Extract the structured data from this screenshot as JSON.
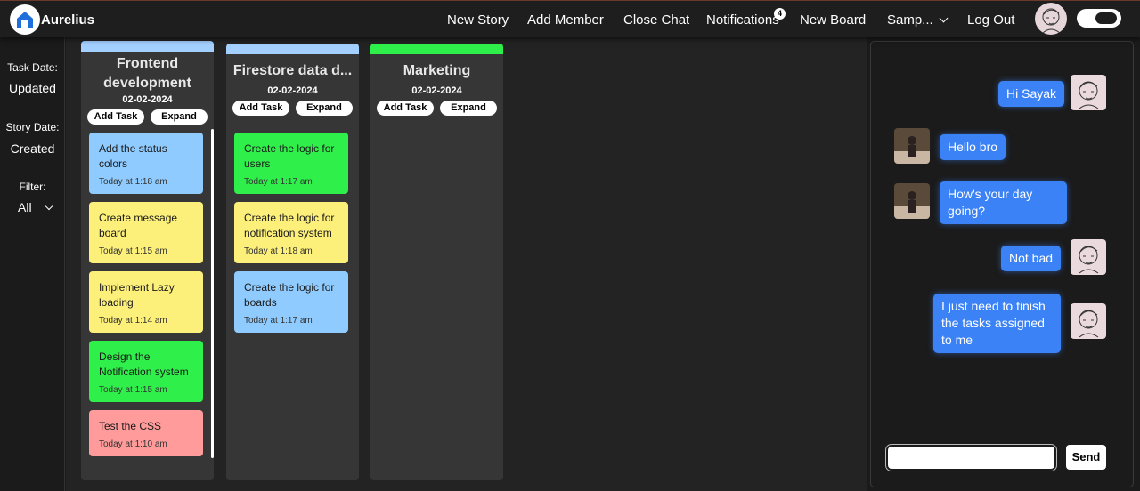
{
  "header": {
    "brand": "Aurelius",
    "nav": [
      {
        "label": "New Story"
      },
      {
        "label": "Add Member"
      },
      {
        "label": "Close Chat"
      },
      {
        "label": "Notifications"
      },
      {
        "label": "New Board"
      },
      {
        "label": "Samp..."
      },
      {
        "label": "Log Out"
      }
    ],
    "notification_count": "4"
  },
  "sidebar": {
    "task_date_label": "Task Date:",
    "task_date_value": "Updated",
    "story_date_label": "Story Date:",
    "story_date_value": "Created",
    "filter_label": "Filter:",
    "filter_value": "All"
  },
  "columns": [
    {
      "title": "Frontend development",
      "date": "02-02-2024",
      "bar_color": "#a3d0ff",
      "add_label": "Add Task",
      "expand_label": "Expand",
      "cards": [
        {
          "title": "Add the status colors",
          "time": "Today at 1:18 am",
          "color": "#8fcbff"
        },
        {
          "title": "Create message board",
          "time": "Today at 1:15 am",
          "color": "#fdf07a"
        },
        {
          "title": "Implement Lazy loading",
          "time": "Today at 1:14 am",
          "color": "#fdf07a"
        },
        {
          "title": "Design the Notification system",
          "time": "Today at 1:15 am",
          "color": "#2ff04a"
        },
        {
          "title": "Test the CSS",
          "time": "Today at 1:10 am",
          "color": "#ff9b9b"
        }
      ]
    },
    {
      "title": "Firestore data d...",
      "date": "02-02-2024",
      "bar_color": "#a3d0ff",
      "add_label": "Add Task",
      "expand_label": "Expand",
      "cards": [
        {
          "title": "Create the logic for users",
          "time": "Today at 1:17 am",
          "color": "#2ff04a"
        },
        {
          "title": "Create the logic for notification system",
          "time": "Today at 1:18 am",
          "color": "#fdf07a"
        },
        {
          "title": "Create the logic for boards",
          "time": "Today at 1:17 am",
          "color": "#8fcbff"
        }
      ]
    },
    {
      "title": "Marketing",
      "date": "02-02-2024",
      "bar_color": "#2ff04a",
      "add_label": "Add Task",
      "expand_label": "Expand",
      "cards": []
    }
  ],
  "chat": {
    "messages": [
      {
        "text": "Hi Sayak",
        "from": "me"
      },
      {
        "text": "Hello bro",
        "from": "other"
      },
      {
        "text": "How's your day going?",
        "from": "other"
      },
      {
        "text": "Not bad",
        "from": "me"
      },
      {
        "text": "I just need to finish the tasks assigned to me",
        "from": "me"
      }
    ],
    "input_value": "",
    "send_label": "Send"
  }
}
